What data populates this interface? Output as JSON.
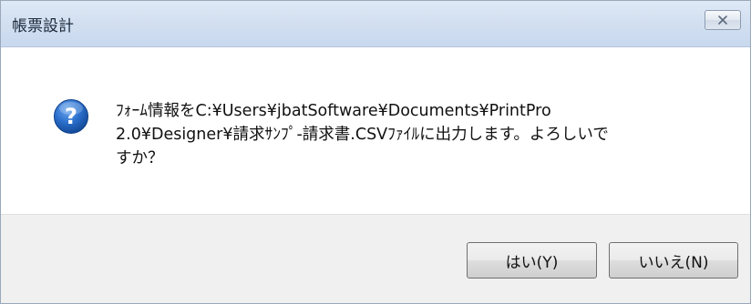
{
  "window": {
    "title": "帳票設計",
    "close_icon": "close-icon"
  },
  "message": {
    "icon": "question-icon",
    "lines": [
      "ﾌｫｰﾑ情報をC:¥Users¥jbatSoftware¥Documents¥PrintPro",
      "2.0¥Designer¥請求ｻﾝﾌﾟ-請求書.CSVﾌｧｲﾙに出力します。よろしいで",
      "すか？"
    ]
  },
  "buttons": {
    "yes_label": "はい(Y)",
    "no_label": "いいえ(N)"
  },
  "colors": {
    "titlebar": "#d3e0f1",
    "footer": "#f0f0f0",
    "icon_blue": "#1f5fb8"
  }
}
